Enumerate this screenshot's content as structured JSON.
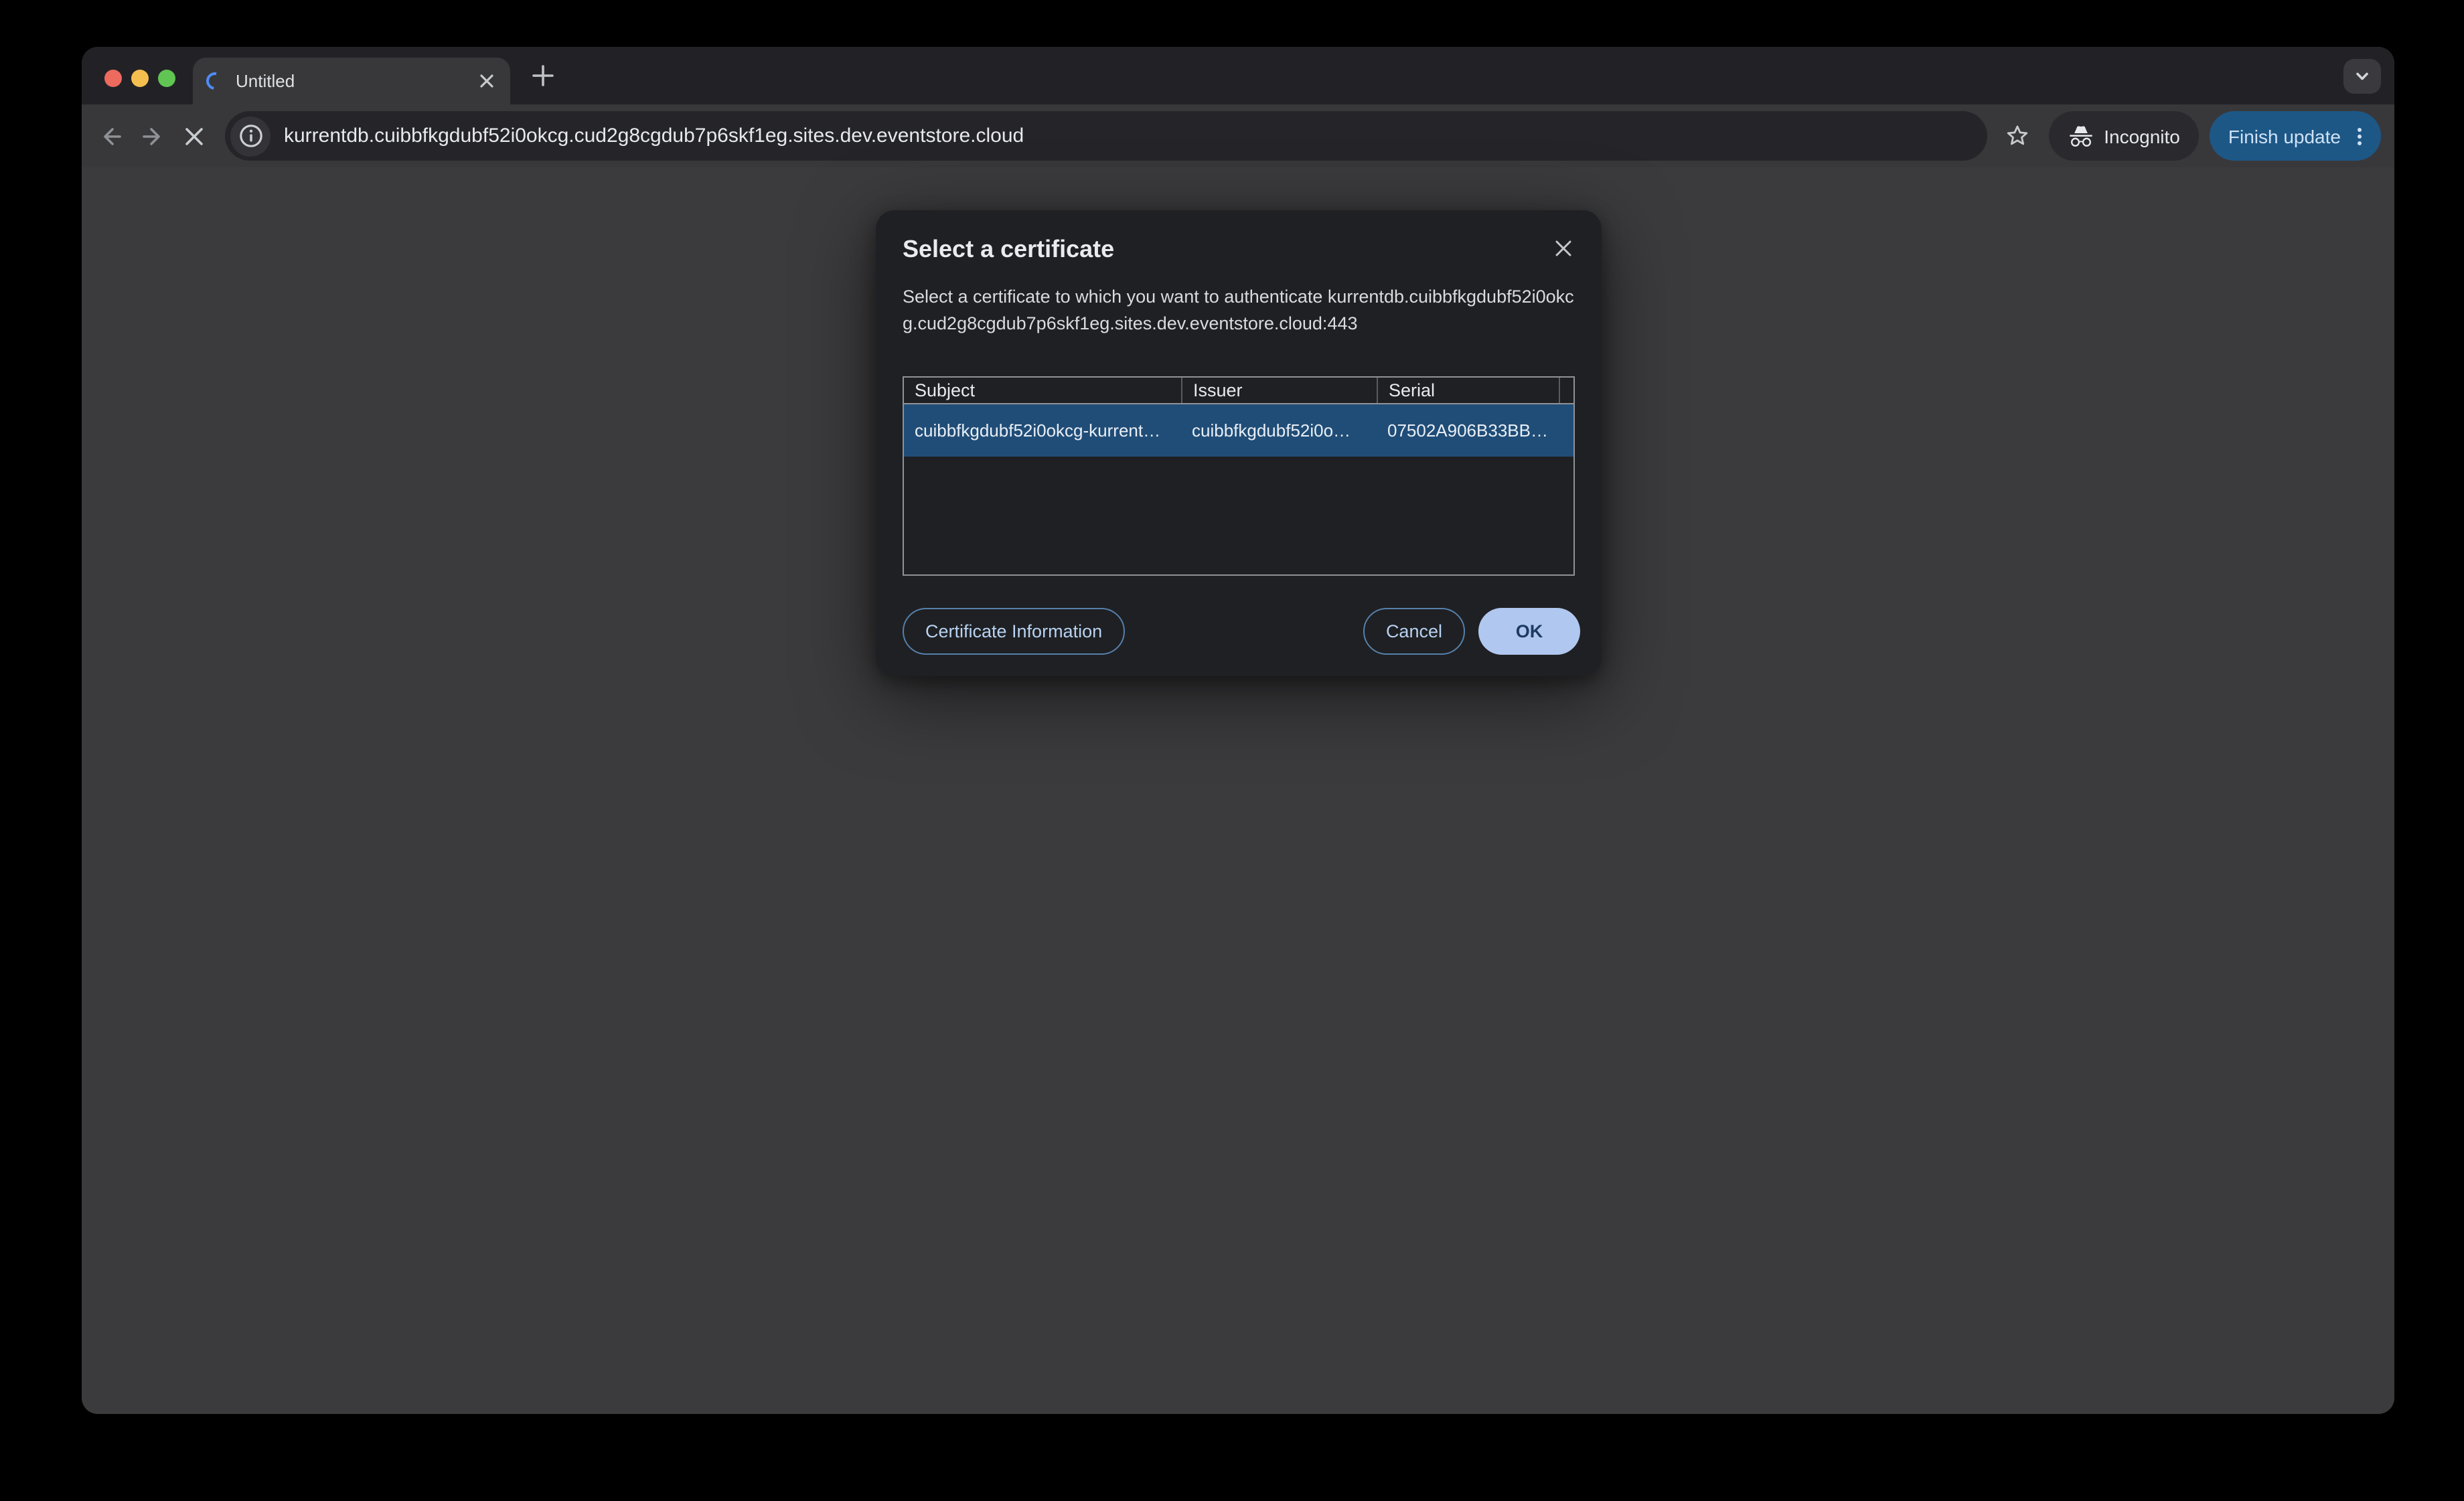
{
  "tab_strip": {
    "tab_title": "Untitled"
  },
  "toolbar": {
    "url": "kurrentdb.cuibbfkgdubf52i0okcg.cud2g8cgdub7p6skf1eg.sites.dev.eventstore.cloud",
    "incognito_label": "Incognito",
    "update_button_label": "Finish update"
  },
  "dialog": {
    "title": "Select a certificate",
    "description": "Select a certificate to which you want to authenticate",
    "host": "kurrentdb.cuibbfkgdubf52i0okcg.cud2g8cgdub7p6skf1eg.sites.dev.eventstore.cloud:443",
    "table": {
      "headers": [
        "Subject",
        "Issuer",
        "Serial"
      ],
      "rows": [
        {
          "subject": "cuibbfkgdubf52i0okcg-kurrent…",
          "issuer": "cuibbfkgdubf52i0o…",
          "serial": "07502A906B33BB…"
        }
      ]
    },
    "buttons": {
      "certificate_information": "Certificate Information",
      "cancel": "Cancel",
      "ok": "OK"
    }
  },
  "colors": {
    "selected_row_blue": "#204d77",
    "update_button_bg": "#1d5786",
    "update_button_text": "#cfe2f5",
    "ok_button_bg": "#b0c7f0",
    "ok_button_text": "#1d3a63",
    "traffic_red": "#ed6a5f",
    "traffic_yellow": "#f5bf4f",
    "traffic_green": "#61c554",
    "spinner_blue": "#4f8df5"
  },
  "icons": {
    "tab_favicon": "loading-spinner-icon",
    "nav": [
      "back-arrow-icon",
      "forward-arrow-icon",
      "stop-loading-icon"
    ],
    "address": [
      "site-info-icon"
    ],
    "right": [
      "bookmark-star-icon",
      "incognito-icon",
      "kebab-menu-icon"
    ],
    "dialog": [
      "close-icon"
    ]
  }
}
